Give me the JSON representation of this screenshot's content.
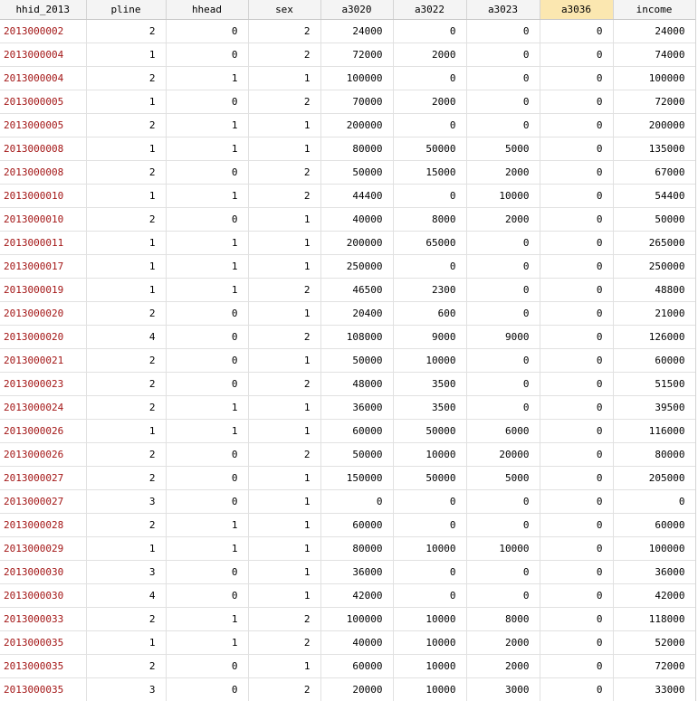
{
  "columns": [
    "hhid_2013",
    "pline",
    "hhead",
    "sex",
    "a3020",
    "a3022",
    "a3023",
    "a3036",
    "income"
  ],
  "rows": [
    [
      "2013000002",
      "2",
      "0",
      "2",
      "24000",
      "0",
      "0",
      "0",
      "24000"
    ],
    [
      "2013000004",
      "1",
      "0",
      "2",
      "72000",
      "2000",
      "0",
      "0",
      "74000"
    ],
    [
      "2013000004",
      "2",
      "1",
      "1",
      "100000",
      "0",
      "0",
      "0",
      "100000"
    ],
    [
      "2013000005",
      "1",
      "0",
      "2",
      "70000",
      "2000",
      "0",
      "0",
      "72000"
    ],
    [
      "2013000005",
      "2",
      "1",
      "1",
      "200000",
      "0",
      "0",
      "0",
      "200000"
    ],
    [
      "2013000008",
      "1",
      "1",
      "1",
      "80000",
      "50000",
      "5000",
      "0",
      "135000"
    ],
    [
      "2013000008",
      "2",
      "0",
      "2",
      "50000",
      "15000",
      "2000",
      "0",
      "67000"
    ],
    [
      "2013000010",
      "1",
      "1",
      "2",
      "44400",
      "0",
      "10000",
      "0",
      "54400"
    ],
    [
      "2013000010",
      "2",
      "0",
      "1",
      "40000",
      "8000",
      "2000",
      "0",
      "50000"
    ],
    [
      "2013000011",
      "1",
      "1",
      "1",
      "200000",
      "65000",
      "0",
      "0",
      "265000"
    ],
    [
      "2013000017",
      "1",
      "1",
      "1",
      "250000",
      "0",
      "0",
      "0",
      "250000"
    ],
    [
      "2013000019",
      "1",
      "1",
      "2",
      "46500",
      "2300",
      "0",
      "0",
      "48800"
    ],
    [
      "2013000020",
      "2",
      "0",
      "1",
      "20400",
      "600",
      "0",
      "0",
      "21000"
    ],
    [
      "2013000020",
      "4",
      "0",
      "2",
      "108000",
      "9000",
      "9000",
      "0",
      "126000"
    ],
    [
      "2013000021",
      "2",
      "0",
      "1",
      "50000",
      "10000",
      "0",
      "0",
      "60000"
    ],
    [
      "2013000023",
      "2",
      "0",
      "2",
      "48000",
      "3500",
      "0",
      "0",
      "51500"
    ],
    [
      "2013000024",
      "2",
      "1",
      "1",
      "36000",
      "3500",
      "0",
      "0",
      "39500"
    ],
    [
      "2013000026",
      "1",
      "1",
      "1",
      "60000",
      "50000",
      "6000",
      "0",
      "116000"
    ],
    [
      "2013000026",
      "2",
      "0",
      "2",
      "50000",
      "10000",
      "20000",
      "0",
      "80000"
    ],
    [
      "2013000027",
      "2",
      "0",
      "1",
      "150000",
      "50000",
      "5000",
      "0",
      "205000"
    ],
    [
      "2013000027",
      "3",
      "0",
      "1",
      "0",
      "0",
      "0",
      "0",
      "0"
    ],
    [
      "2013000028",
      "2",
      "1",
      "1",
      "60000",
      "0",
      "0",
      "0",
      "60000"
    ],
    [
      "2013000029",
      "1",
      "1",
      "1",
      "80000",
      "10000",
      "10000",
      "0",
      "100000"
    ],
    [
      "2013000030",
      "3",
      "0",
      "1",
      "36000",
      "0",
      "0",
      "0",
      "36000"
    ],
    [
      "2013000030",
      "4",
      "0",
      "1",
      "42000",
      "0",
      "0",
      "0",
      "42000"
    ],
    [
      "2013000033",
      "2",
      "1",
      "2",
      "100000",
      "10000",
      "8000",
      "0",
      "118000"
    ],
    [
      "2013000035",
      "1",
      "1",
      "2",
      "40000",
      "10000",
      "2000",
      "0",
      "52000"
    ],
    [
      "2013000035",
      "2",
      "0",
      "1",
      "60000",
      "10000",
      "2000",
      "0",
      "72000"
    ],
    [
      "2013000035",
      "3",
      "0",
      "2",
      "20000",
      "10000",
      "3000",
      "0",
      "33000"
    ]
  ],
  "selected_column": "a3036",
  "colors": {
    "id_text": "#a31515",
    "header_bg": "#f4f4f4",
    "selected_header_bg": "#fbe7b0",
    "grid_line": "#e1e1e1"
  }
}
